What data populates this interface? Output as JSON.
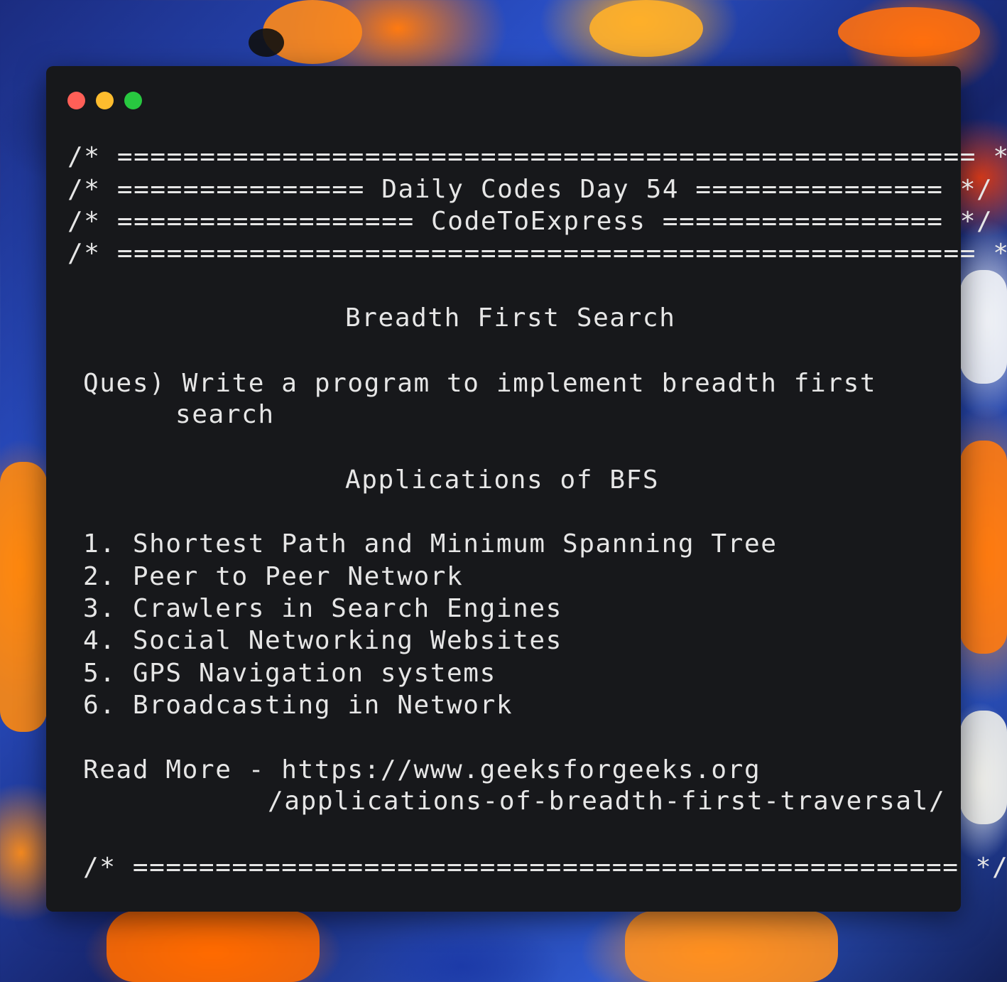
{
  "window": {
    "controls": [
      {
        "name": "close",
        "color": "#ff5f57"
      },
      {
        "name": "minimize",
        "color": "#febc2e"
      },
      {
        "name": "zoom",
        "color": "#28c840"
      }
    ]
  },
  "header": {
    "line1": "/* ==================================================== */",
    "line2": "/* =============== Daily Codes Day 54 =============== */",
    "line3": "/* ================== CodeToExpress ================= */",
    "line4": "/* ==================================================== */"
  },
  "title": "Breadth First Search",
  "question": {
    "line1": "Ques) Write a program to implement breadth first",
    "line2": "search"
  },
  "applications": {
    "heading": "Applications of BFS",
    "items": [
      "1. Shortest Path and Minimum Spanning Tree",
      "2. Peer to Peer Network",
      "3. Crawlers in Search Engines",
      "4. Social Networking Websites",
      "5. GPS Navigation systems",
      "6. Broadcasting in Network"
    ]
  },
  "read_more": {
    "line1": "Read More - https://www.geeksforgeeks.org",
    "line2": "/applications-of-breadth-first-traversal/"
  },
  "footer": "/* ================================================== */"
}
